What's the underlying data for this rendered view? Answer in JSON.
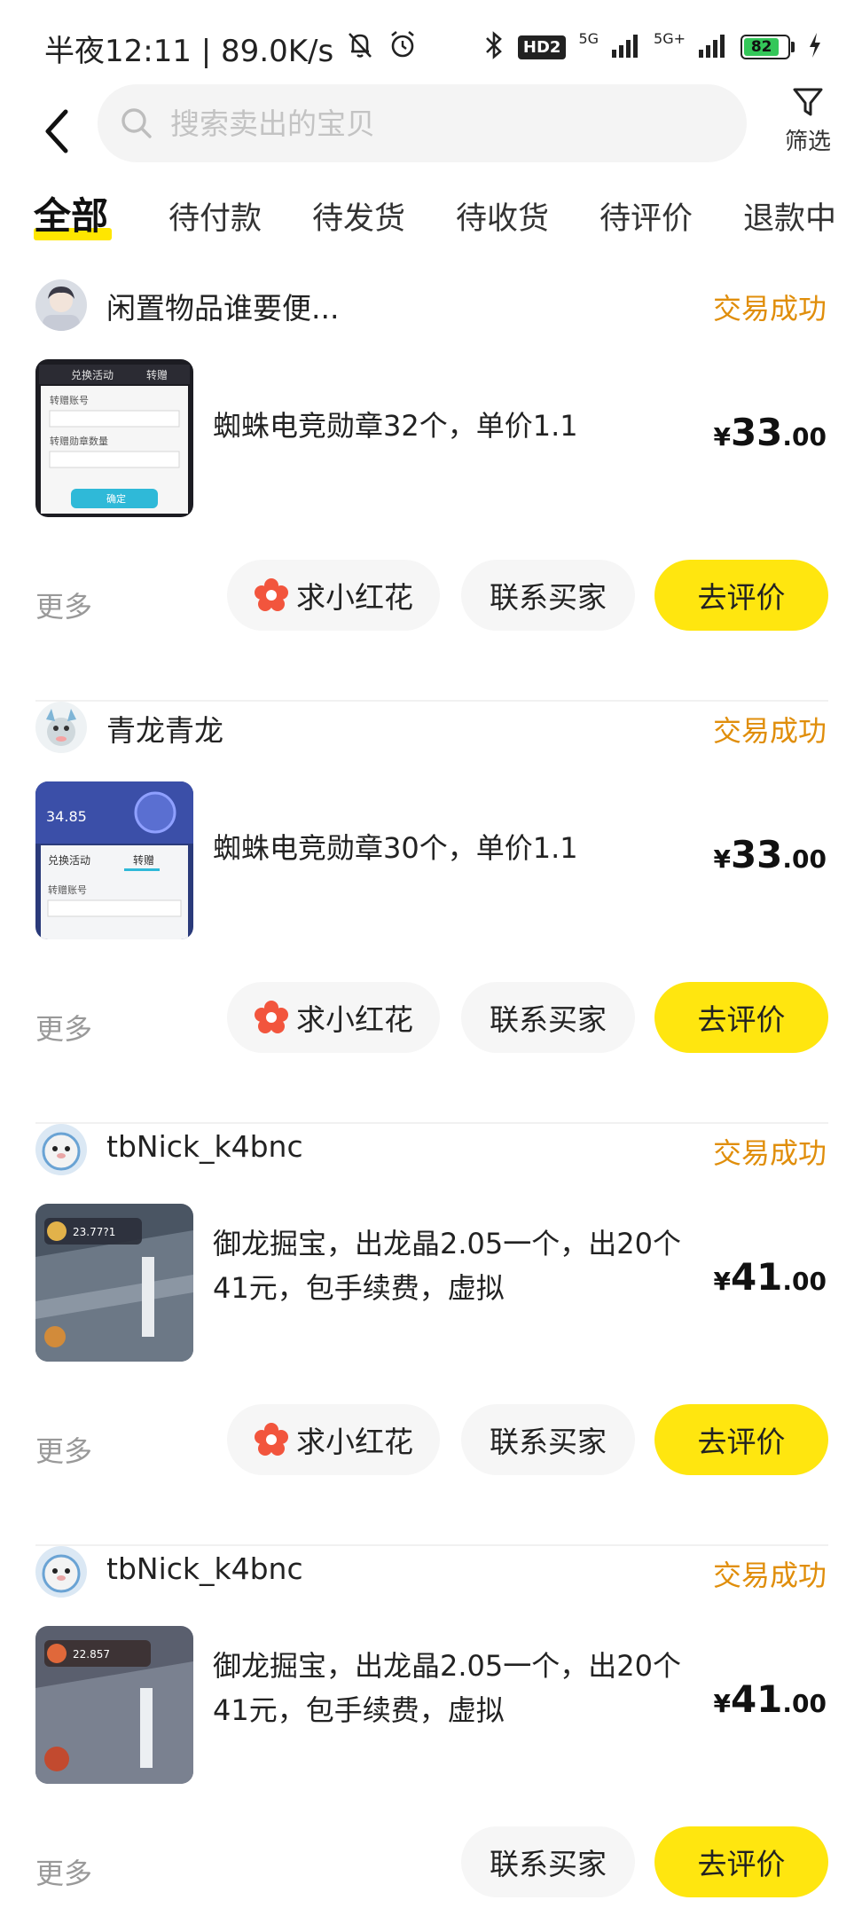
{
  "status_bar": {
    "time_text": "半夜12:11 | 89.0K/s",
    "hd_badge": "HD2",
    "net1": "5G",
    "net2": "5G+",
    "battery": "82",
    "battery_level": 0.82
  },
  "header": {
    "search_placeholder": "搜索卖出的宝贝",
    "filter_label": "筛选"
  },
  "tabs": [
    {
      "label": "全部",
      "active": true
    },
    {
      "label": "待付款"
    },
    {
      "label": "待发货"
    },
    {
      "label": "待收货"
    },
    {
      "label": "待评价"
    },
    {
      "label": "退款中"
    }
  ],
  "actions": {
    "more": "更多",
    "flower": "求小红花",
    "contact": "联系买家",
    "review": "去评价"
  },
  "orders": [
    {
      "buyer": "闲置物品谁要便...",
      "status": "交易成功",
      "title": "蜘蛛电竞勋章32个，单价1.1",
      "currency": "¥",
      "price_int": "33",
      "price_dec": ".00"
    },
    {
      "buyer": "青龙青龙",
      "status": "交易成功",
      "title": "蜘蛛电竞勋章30个，单价1.1",
      "currency": "¥",
      "price_int": "33",
      "price_dec": ".00"
    },
    {
      "buyer": "tbNick_k4bnc",
      "status": "交易成功",
      "title": "御龙掘宝，出龙晶2.05一个，出20个41元，包手续费，虚拟",
      "currency": "¥",
      "price_int": "41",
      "price_dec": ".00"
    },
    {
      "buyer": "tbNick_k4bnc",
      "status": "交易成功",
      "title": "御龙掘宝，出龙晶2.05一个，出20个41元，包手续费，虚拟",
      "currency": "¥",
      "price_int": "41",
      "price_dec": ".00"
    }
  ],
  "thumb_texts": {
    "t1_tab_a": "兑换活动",
    "t1_tab_b": "转赠",
    "t1_label_a": "转赠账号",
    "t1_label_b": "转赠勋章数量",
    "t1_btn": "确定",
    "t2_value": "34.85",
    "t2_tab_a": "兑换活动",
    "t2_tab_b": "转赠",
    "t2_label": "转赠账号",
    "t3_value": "23.77?1",
    "t4_value": "22.857"
  }
}
